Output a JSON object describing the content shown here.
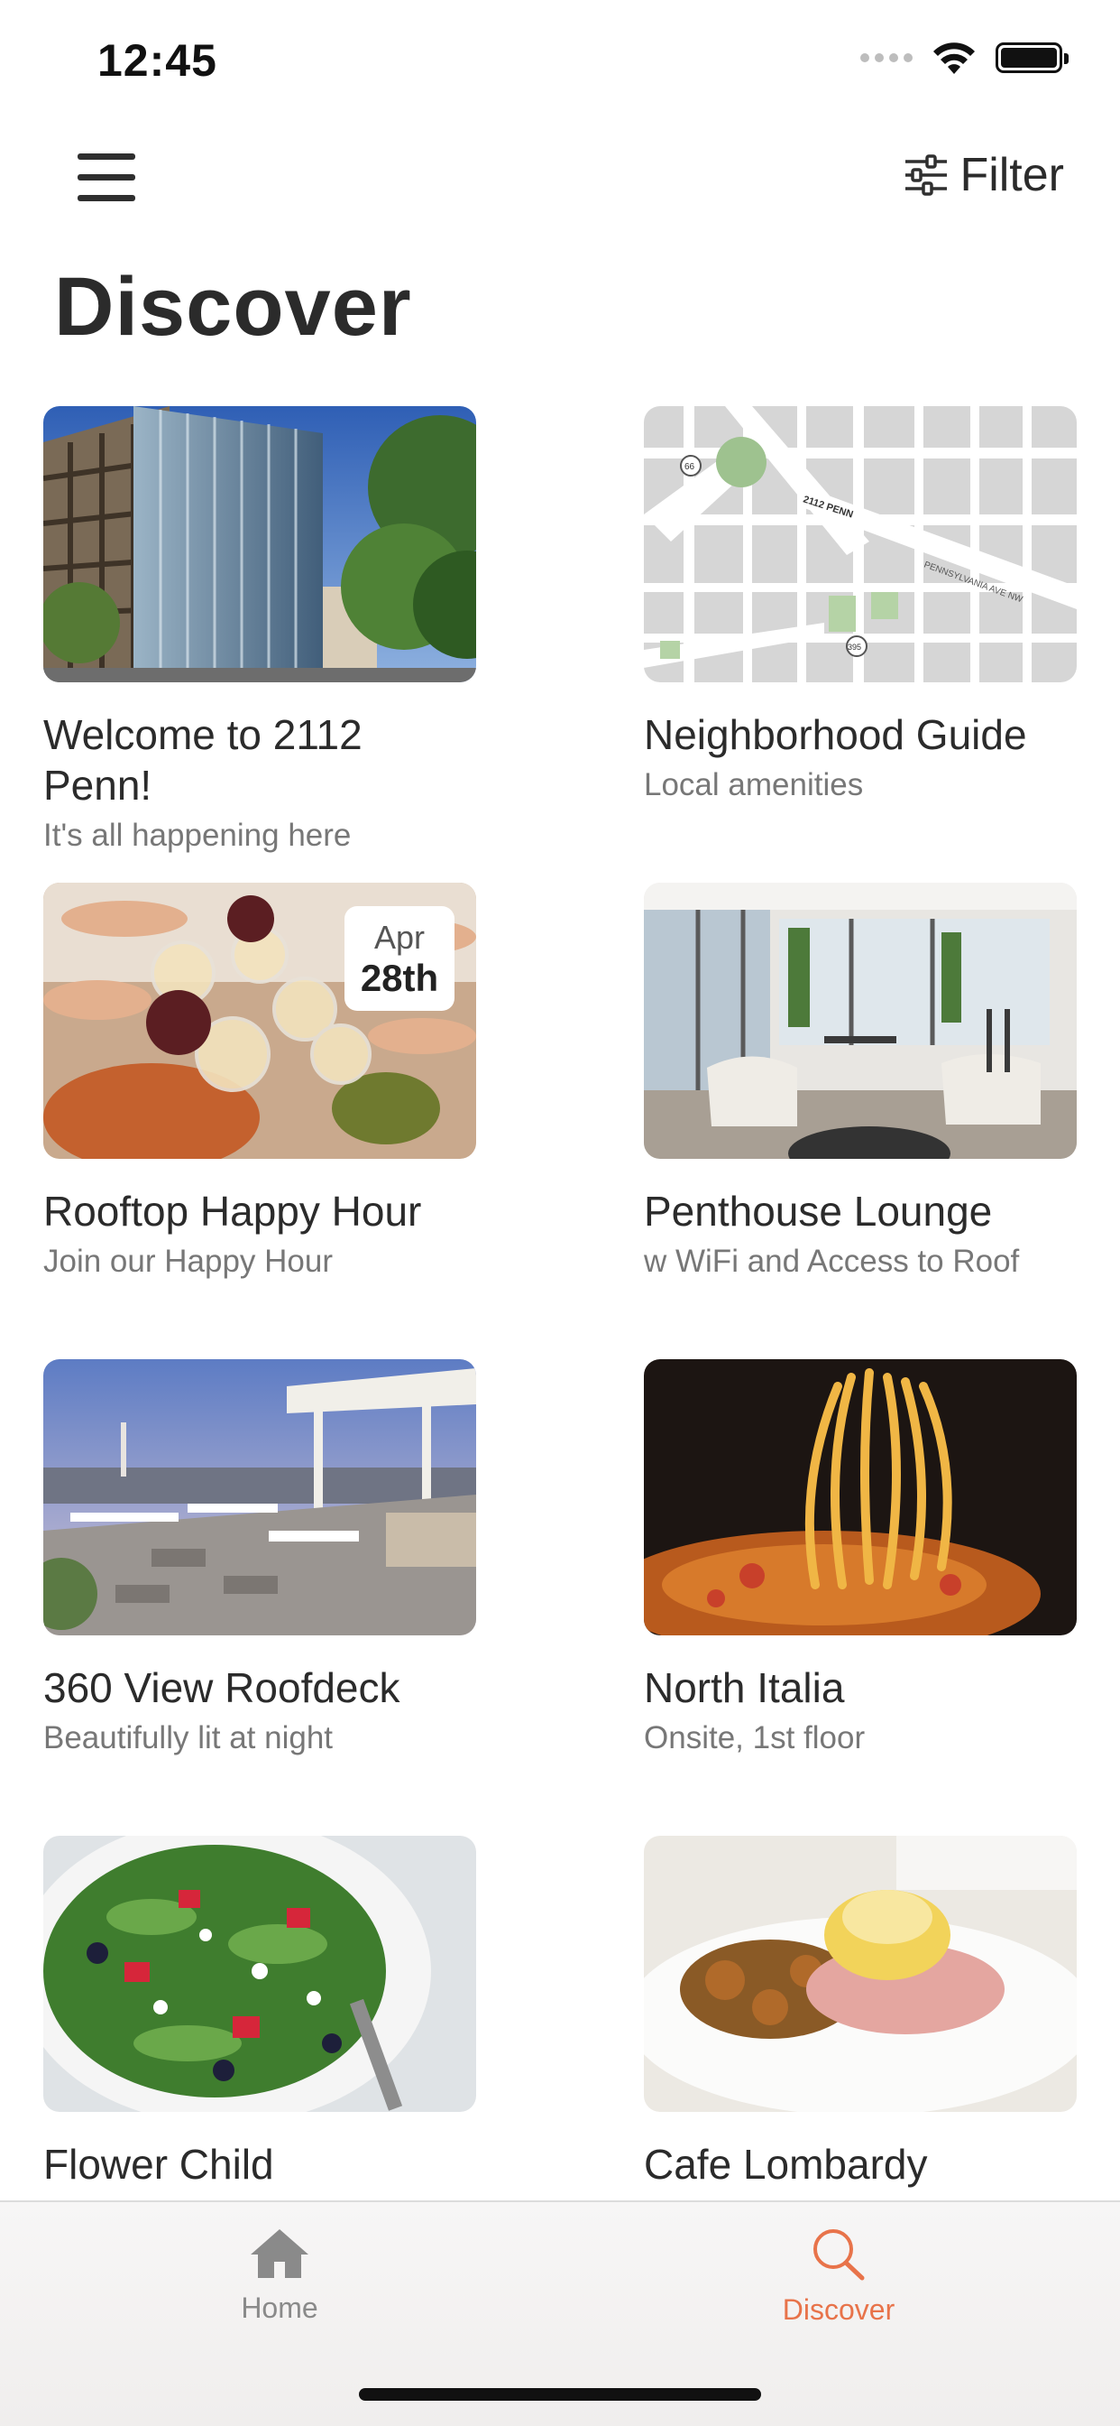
{
  "status_bar": {
    "time": "12:45"
  },
  "header": {
    "filter_label": "Filter"
  },
  "page": {
    "title": "Discover"
  },
  "cards": [
    {
      "title": "Welcome to 2112 Penn!",
      "subtitle": "It's all happening here"
    },
    {
      "title": "Neighborhood Guide",
      "subtitle": "Local amenities"
    },
    {
      "title": "Rooftop Happy Hour",
      "subtitle": "Join our Happy Hour",
      "badge": {
        "month": "Apr",
        "day": "28th"
      }
    },
    {
      "title": "Penthouse Lounge",
      "subtitle": "w WiFi and Access to Roof"
    },
    {
      "title": "360 View Roofdeck",
      "subtitle": "Beautifully lit at night"
    },
    {
      "title": "North Italia",
      "subtitle": "Onsite, 1st floor"
    },
    {
      "title": "Flower Child",
      "subtitle": ""
    },
    {
      "title": "Cafe Lombardy",
      "subtitle": ""
    }
  ],
  "map_labels": {
    "street_main": "2112 PENN",
    "street_ave": "PENNSYLVANIA AVE NW",
    "route_66": "66",
    "route_395": "395"
  },
  "tab_bar": {
    "tabs": [
      {
        "label": "Home",
        "icon": "home-icon",
        "active": false
      },
      {
        "label": "Discover",
        "icon": "search-icon",
        "active": true
      }
    ]
  },
  "colors": {
    "accent": "#e8734a",
    "text_primary": "#2b2b2b",
    "text_secondary": "#777777",
    "tab_inactive": "#8a8a8a"
  }
}
